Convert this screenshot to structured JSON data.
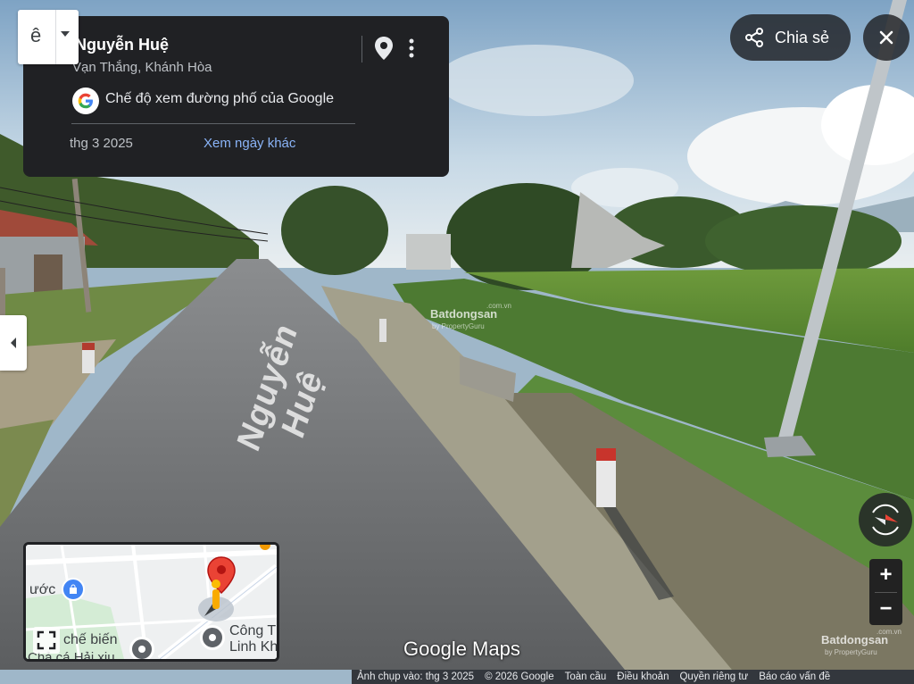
{
  "location": {
    "road_name": "Nguyễn Huệ",
    "area": "Vạn Thắng, Khánh Hòa",
    "street_view_label": "Chế độ xem đường phố của Google",
    "capture_date": "thg 3 2025",
    "other_dates_link": "Xem ngày khác"
  },
  "back_box": {
    "letter": "ê"
  },
  "header": {
    "share_label": "Chia sẻ"
  },
  "road_marking": "Nguyễn Huệ",
  "minimap": {
    "labels": {
      "left_top": "ước",
      "left_mid": "chế biến",
      "left_bot": "Chả cá Hải xịu",
      "right_top": "Công T",
      "right_bot": "Linh Kh"
    }
  },
  "watermarks": {
    "google_maps": "Google Maps",
    "bds_main": "Batdongsan",
    "bds_sub": "by PropertyGuru",
    "bds_domain": ".com.vn"
  },
  "footer": {
    "captured": "Ảnh chụp vào: thg 3 2025",
    "copyright": "© 2026 Google",
    "global": "Toàn cầu",
    "terms": "Điều khoản",
    "privacy": "Quyền riêng tư",
    "report": "Báo cáo vấn đề"
  },
  "zoom": {
    "in": "+",
    "out": "−"
  },
  "colors": {
    "card_bg": "#202124",
    "link": "#8ab4f8",
    "pin_red": "#ea4335"
  }
}
